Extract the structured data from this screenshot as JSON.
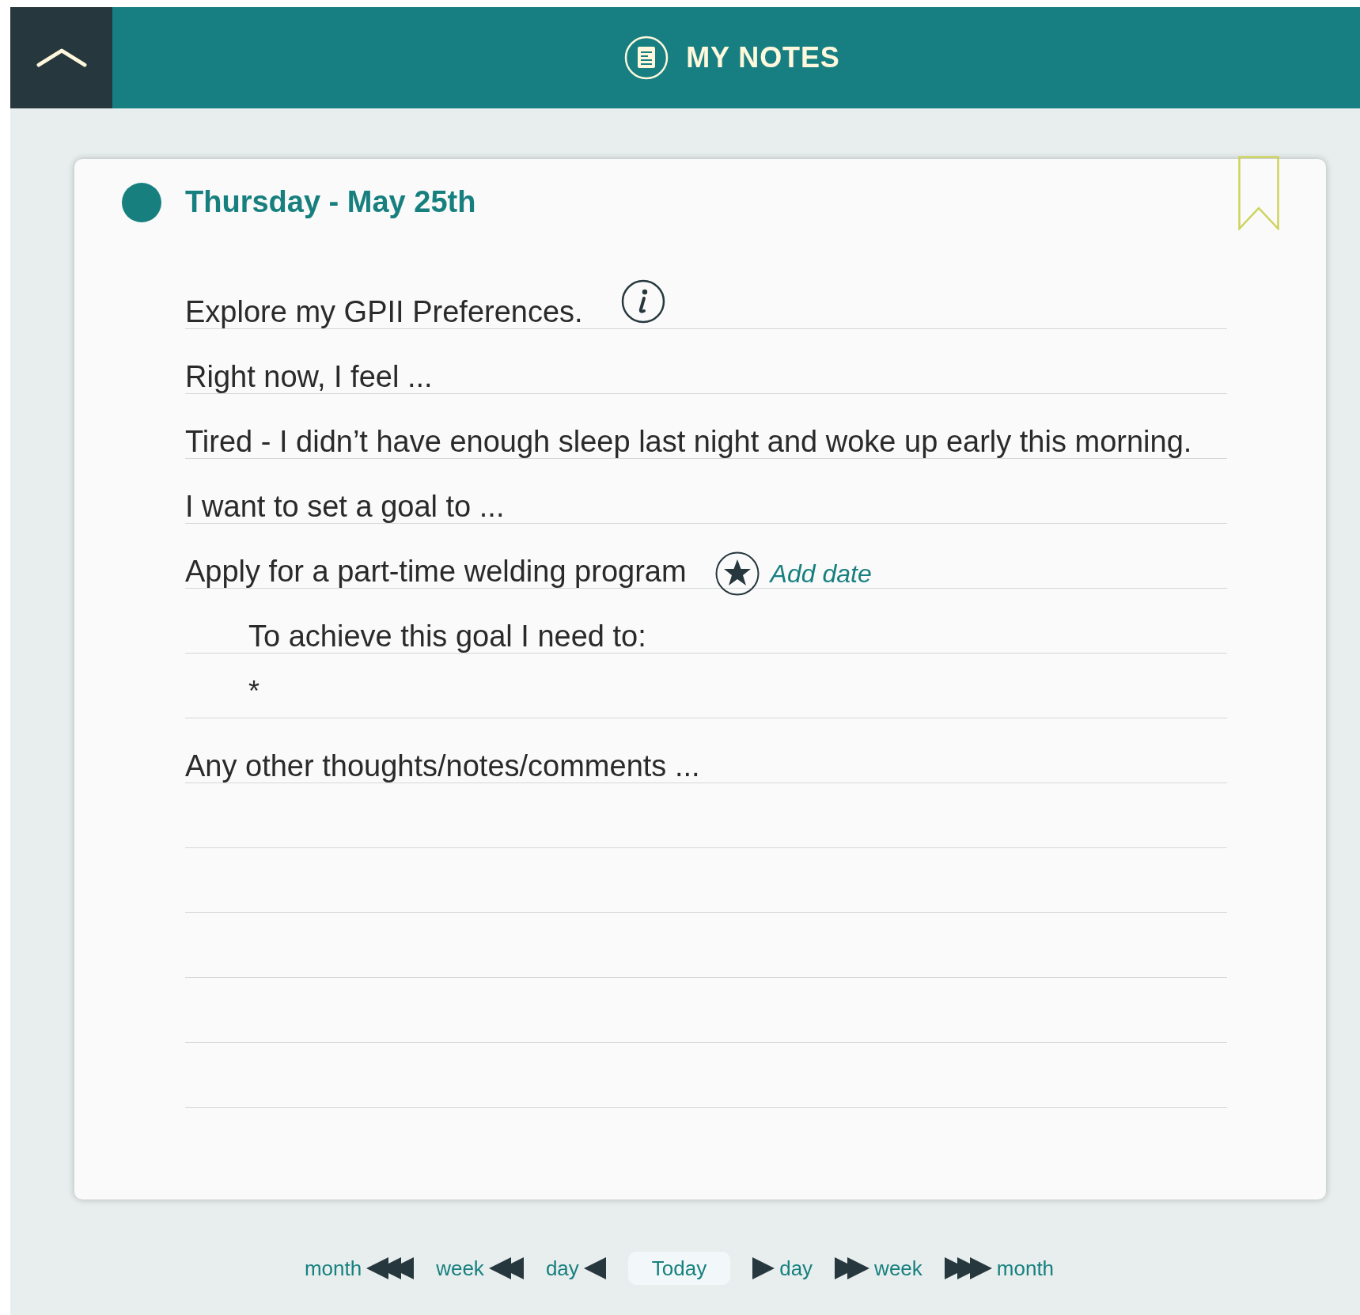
{
  "header": {
    "title": "MY NOTES"
  },
  "entry": {
    "date": "Thursday - May 25th",
    "color": "#17807f",
    "lines": [
      {
        "kind": "info",
        "text": "Explore my GPII Preferences."
      },
      {
        "kind": "prompt",
        "text": "Right now, I feel ..."
      },
      {
        "kind": "prompt",
        "text": "Tired - I didn’t have enough sleep last night and woke up early this morning."
      },
      {
        "kind": "prompt",
        "text": "I want to set a goal to ..."
      },
      {
        "kind": "goal",
        "text": "Apply for a part-time welding program",
        "link": "Add date"
      },
      {
        "kind": "indented",
        "text": "To achieve this goal I need to:"
      },
      {
        "kind": "bullet",
        "text": "*"
      },
      {
        "kind": "prompt",
        "text": "Any other thoughts/notes/comments ..."
      },
      {
        "kind": "blank"
      },
      {
        "kind": "blank"
      },
      {
        "kind": "blank"
      },
      {
        "kind": "blank"
      },
      {
        "kind": "blank"
      }
    ]
  },
  "navigation": [
    {
      "label": "month",
      "kind": "back3"
    },
    {
      "label": "week",
      "kind": "back2"
    },
    {
      "label": "day",
      "kind": "back1"
    },
    {
      "label": "Today",
      "kind": "today"
    },
    {
      "label": "day",
      "kind": "forward1"
    },
    {
      "label": "week",
      "kind": "forward2"
    },
    {
      "label": "month",
      "kind": "forward3"
    }
  ]
}
